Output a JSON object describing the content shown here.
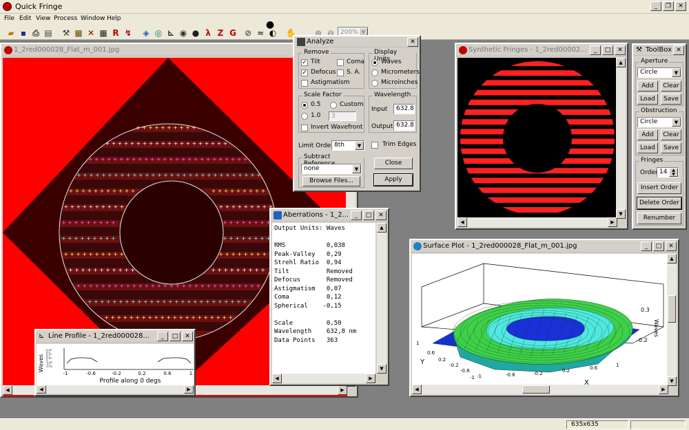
{
  "app": {
    "title": "Quick Fringe",
    "menus": [
      "File",
      "Edit",
      "View",
      "Process",
      "Window",
      "Help"
    ],
    "zoom_value": "200%"
  },
  "image_window": {
    "title": "1_2red000028_Flat_m_001.jpg"
  },
  "analyze": {
    "title": "Analyze",
    "remove_label": "Remove",
    "tilt": "Tilt",
    "tilt_checked": true,
    "coma": "Coma",
    "coma_checked": false,
    "defocus": "Defocus",
    "defocus_checked": true,
    "sa": "S. A.",
    "sa_checked": false,
    "astigmatism": "Astigmatism",
    "astigmatism_checked": false,
    "display_units_label": "Display Units",
    "waves": "Waves",
    "micrometers": "Micrometers",
    "microinches": "Microinches",
    "selected_unit": "Waves",
    "scale_factor_label": "Scale Factor",
    "scale_05": "0.5",
    "scale_custom": "Custom",
    "scale_10": "1.0",
    "custom_value": "3",
    "invert_wavefront": "Invert Wavefront",
    "wavelength_label": "Wavelength",
    "input_label": "Input",
    "input_value": "632.8",
    "output_label": "Output",
    "output_value": "632.8",
    "limit_order_label": "Limit Order",
    "limit_order_value": "8th",
    "trim_edges": "Trim Edges",
    "subtract_reference_label": "Subtract Reference",
    "subtract_reference_value": "none",
    "browse_files": "Browse Files...",
    "close": "Close",
    "apply": "Apply"
  },
  "synthetic": {
    "title": "Synthetic Fringes - 1_2red00002..."
  },
  "toolbox": {
    "title": "ToolBox",
    "aperture_label": "Aperture",
    "aperture_value": "Circle",
    "add": "Add",
    "clear": "Clear",
    "load": "Load",
    "save": "Save",
    "obstruction_label": "Obstruction",
    "obstruction_value": "Circle",
    "fringes_label": "Fringes",
    "order_label": "Order",
    "order_value": "14",
    "insert_order": "Insert Order",
    "delete_order": "Delete Order",
    "renumber": "Renumber"
  },
  "aberrations": {
    "title": "Aberrations - 1_2...",
    "text": "Output Units: Waves\n\nRMS           0,038\nPeak-Valley   0,29\nStrehl Ratio  0,94\nTilt          Removed\nDefocus       Removed\nAstigmatism   0,07\nComa          0,12\nSpherical    -0,15\n\nScale         0,50\nWavelength    632,8 nm\nData Points   363"
  },
  "line_profile": {
    "title": "Line Profile - 1_2red000028...",
    "ylabel": "Waves",
    "yticks": [
      "0.25",
      "0.2",
      "0.15",
      "0.1",
      "0.05",
      "0",
      "-0.05",
      "-0.1",
      "-0.15"
    ],
    "xticks": [
      "-1",
      "-0.6",
      "-0.2",
      "0.2",
      "0.6",
      "1"
    ],
    "xlabel": "Profile along 0 degs"
  },
  "surface_plot": {
    "title": "Surface Plot - 1_2red000028_Flat_m_001.jpg",
    "z_label": "Waves",
    "z_ticks": [
      "0.3",
      "-0.2"
    ],
    "x_label": "X",
    "x_ticks": [
      "-1",
      "-0.6",
      "-0.2",
      "0.2",
      "0.6",
      "1"
    ],
    "y_label": "Y",
    "y_ticks": [
      "1",
      "0.6",
      "0.2",
      "-0.2",
      "-0.6",
      "-1"
    ]
  },
  "status": {
    "dimensions": "635x635"
  },
  "colors": {
    "fringe_red": "#ff2020",
    "background_red": "#ff0000",
    "surface_green": "#40e040",
    "surface_blue": "#1830d0"
  }
}
